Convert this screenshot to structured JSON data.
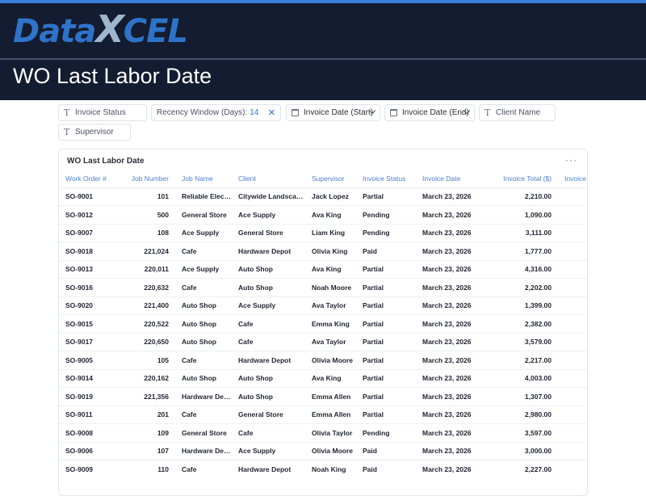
{
  "brand": {
    "logo_part1": "Data",
    "logo_part2": "X",
    "logo_part3": "CEL"
  },
  "header": {
    "title": "WO Last Labor Date"
  },
  "filters": {
    "invoice_status": "Invoice Status",
    "recency_label": "Recency Window (Days):",
    "recency_value": "14",
    "invoice_date_start": "Invoice Date (Start)",
    "invoice_date_end": "Invoice Date (End)",
    "client_name": "Client Name",
    "supervisor": "Supervisor"
  },
  "card": {
    "title": "WO Last Labor Date"
  },
  "table": {
    "columns": [
      "Work Order #",
      "Job Number",
      "Job Name",
      "Client",
      "Supervisor",
      "Invoice Status",
      "Invoice Date",
      "Invoice Total ($)",
      "Invoice Bala"
    ],
    "rows": [
      [
        "SO-9001",
        "101",
        "Reliable Electric",
        "Citywide Landscaping",
        "Jack Lopez",
        "Partial",
        "March 23, 2026",
        "2,210.00",
        ""
      ],
      [
        "SO-9012",
        "500",
        "General Store",
        "Ace Supply",
        "Ava King",
        "Pending",
        "March 23, 2026",
        "1,090.00",
        ""
      ],
      [
        "SO-9007",
        "108",
        "Ace Supply",
        "General Store",
        "Liam King",
        "Pending",
        "March 23, 2026",
        "3,111.00",
        ""
      ],
      [
        "SO-9018",
        "221,024",
        "Cafe",
        "Hardware Depot",
        "Olivia King",
        "Paid",
        "March 23, 2026",
        "1,777.00",
        ""
      ],
      [
        "SO-9013",
        "220,011",
        "Ace Supply",
        "Auto Shop",
        "Ava King",
        "Partial",
        "March 23, 2026",
        "4,316.00",
        ""
      ],
      [
        "SO-9016",
        "220,632",
        "Cafe",
        "Auto Shop",
        "Noah Moore",
        "Partial",
        "March 23, 2026",
        "2,202.00",
        ""
      ],
      [
        "SO-9020",
        "221,400",
        "Auto Shop",
        "Ace Supply",
        "Ava Taylor",
        "Partial",
        "March 23, 2026",
        "1,399.00",
        ""
      ],
      [
        "SO-9015",
        "220,522",
        "Auto Shop",
        "Cafe",
        "Emma King",
        "Partial",
        "March 23, 2026",
        "2,382.00",
        ""
      ],
      [
        "SO-9017",
        "220,650",
        "Auto Shop",
        "Cafe",
        "Ava Taylor",
        "Partial",
        "March 23, 2026",
        "3,579.00",
        ""
      ],
      [
        "SO-9005",
        "105",
        "Cafe",
        "Hardware Depot",
        "Olivia Moore",
        "Partial",
        "March 23, 2026",
        "2,217.00",
        ""
      ],
      [
        "SO-9014",
        "220,162",
        "Auto Shop",
        "Auto Shop",
        "Ava King",
        "Partial",
        "March 23, 2026",
        "4,003.00",
        ""
      ],
      [
        "SO-9019",
        "221,356",
        "Hardware Dep...",
        "Auto Shop",
        "Emma Allen",
        "Partial",
        "March 23, 2026",
        "1,307.00",
        ""
      ],
      [
        "SO-9011",
        "201",
        "Cafe",
        "General Store",
        "Emma Allen",
        "Partial",
        "March 23, 2026",
        "2,980.00",
        ""
      ],
      [
        "SO-9008",
        "109",
        "General Store",
        "Cafe",
        "Olivia Taylor",
        "Pending",
        "March 23, 2026",
        "3,597.00",
        ""
      ],
      [
        "SO-9006",
        "107",
        "Hardware Dep...",
        "Ace Supply",
        "Olivia Moore",
        "Paid",
        "March 23, 2026",
        "3,000.00",
        ""
      ],
      [
        "SO-9009",
        "110",
        "Cafe",
        "Hardware Depot",
        "Noah King",
        "Paid",
        "March 23, 2026",
        "2,227.00",
        ""
      ]
    ]
  }
}
